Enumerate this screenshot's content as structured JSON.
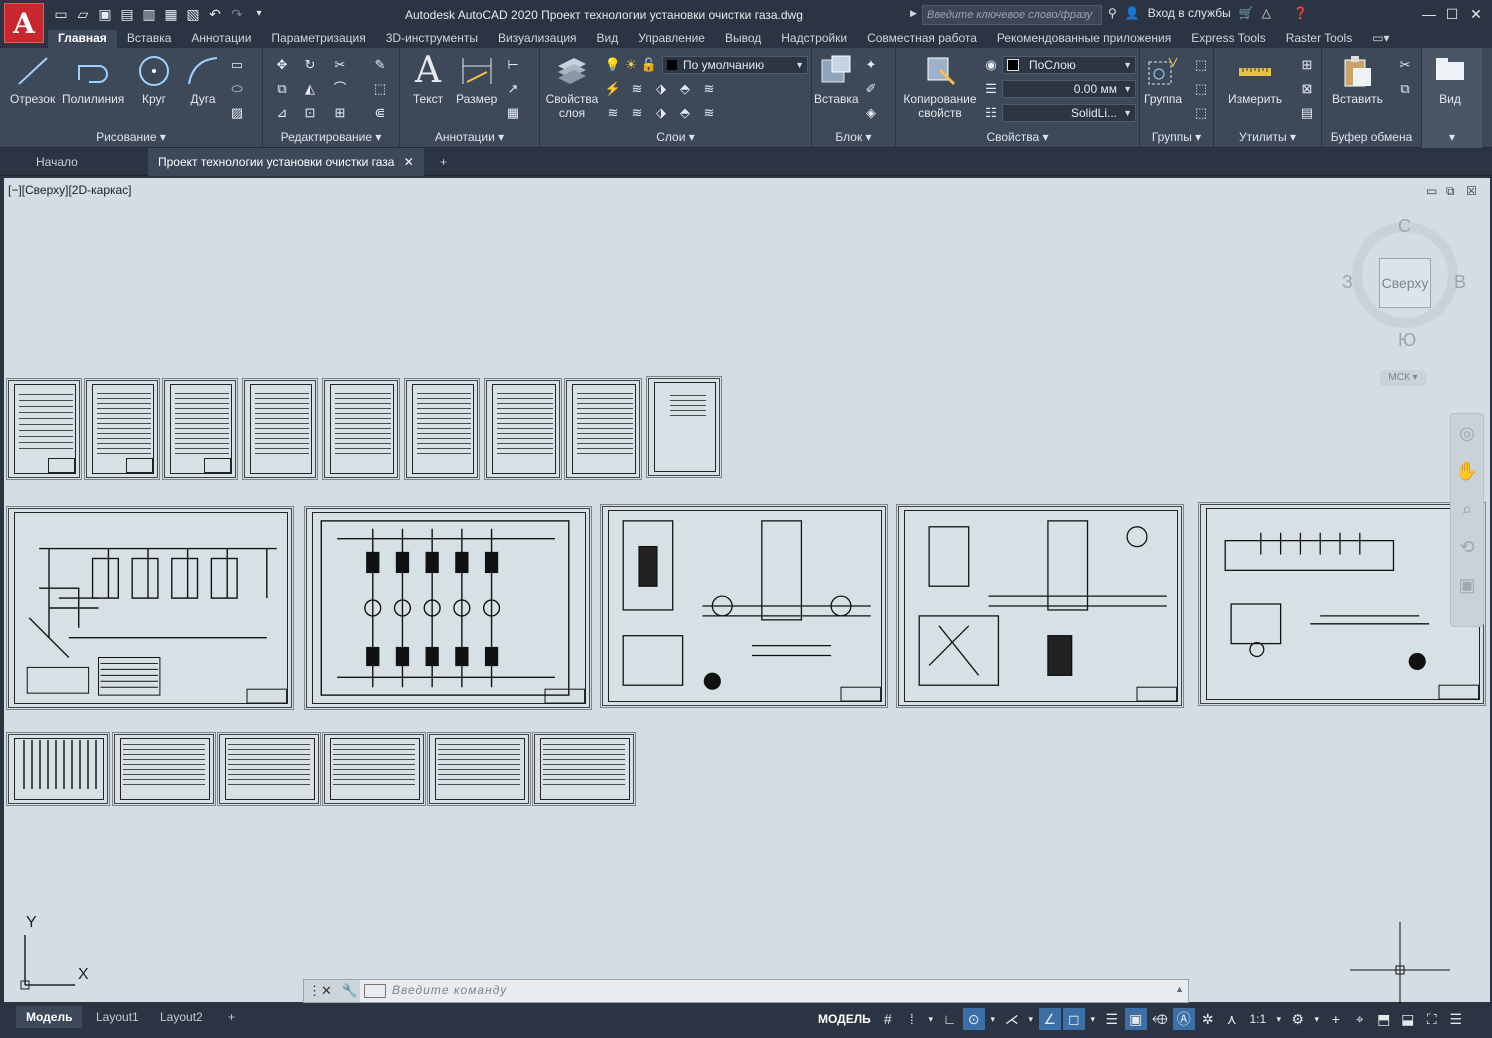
{
  "app": {
    "logo": "A",
    "title": "Autodesk AutoCAD 2020   Проект технологии установки очистки газа.dwg",
    "search_placeholder": "Введите ключевое слово/фразу",
    "signin": "Вход в службы",
    "quick_access_icons": [
      "new-icon",
      "open-icon",
      "save-icon",
      "saveas-icon",
      "webmobile-icon",
      "print-icon",
      "plot-icon",
      "undo-icon",
      "redo-icon",
      "dropdown-icon"
    ]
  },
  "ribbon_tabs": [
    "Главная",
    "Вставка",
    "Аннотации",
    "Параметризация",
    "3D-инструменты",
    "Визуализация",
    "Вид",
    "Управление",
    "Вывод",
    "Надстройки",
    "Совместная работа",
    "Рекомендованные приложения",
    "Express Tools",
    "Raster Tools"
  ],
  "panels": {
    "draw": {
      "title": "Рисование",
      "line": "Отрезок",
      "polyline": "Полилиния",
      "circle": "Круг",
      "arc": "Дуга"
    },
    "modify": {
      "title": "Редактирование"
    },
    "annotation": {
      "title": "Аннотации",
      "text": "Текст",
      "dimension": "Размер"
    },
    "layers": {
      "title": "Слои",
      "layer_props": "Свойства слоя",
      "current_layer": "По умолчанию"
    },
    "block": {
      "title": "Блок",
      "insert": "Вставка"
    },
    "properties": {
      "title": "Свойства",
      "match": "Копирование свойств",
      "color": "ПоСлою",
      "lineweight": "0.00 мм",
      "linetype": "SolidLi..."
    },
    "groups": {
      "title": "Группы",
      "group": "Группа"
    },
    "utilities": {
      "title": "Утилиты",
      "measure": "Измерить"
    },
    "clipboard": {
      "title": "Буфер обмена",
      "paste": "Вставить"
    },
    "view": {
      "title": "Вид"
    }
  },
  "file_tabs": {
    "start": "Начало",
    "active": "Проект технологии установки очистки газа"
  },
  "viewport": {
    "label": "[−][Сверху][2D-каркас]",
    "viewcube": {
      "face": "Сверху",
      "north": "С",
      "south": "Ю",
      "west": "З",
      "east": "В"
    },
    "ucs_menu": "МСК",
    "ucs_x": "X",
    "ucs_y": "Y"
  },
  "command_line": {
    "placeholder": "Введите  команду"
  },
  "layouts": [
    "Модель",
    "Layout1",
    "Layout2"
  ],
  "status": {
    "model": "МОДЕЛЬ",
    "scale": "1:1"
  },
  "colors": {
    "accent_blue": "#3c6ea8",
    "canvas": "#d3dde3",
    "ribbon": "#3d4859",
    "titlebar": "#2b3442",
    "logo_red": "#c8282d"
  }
}
